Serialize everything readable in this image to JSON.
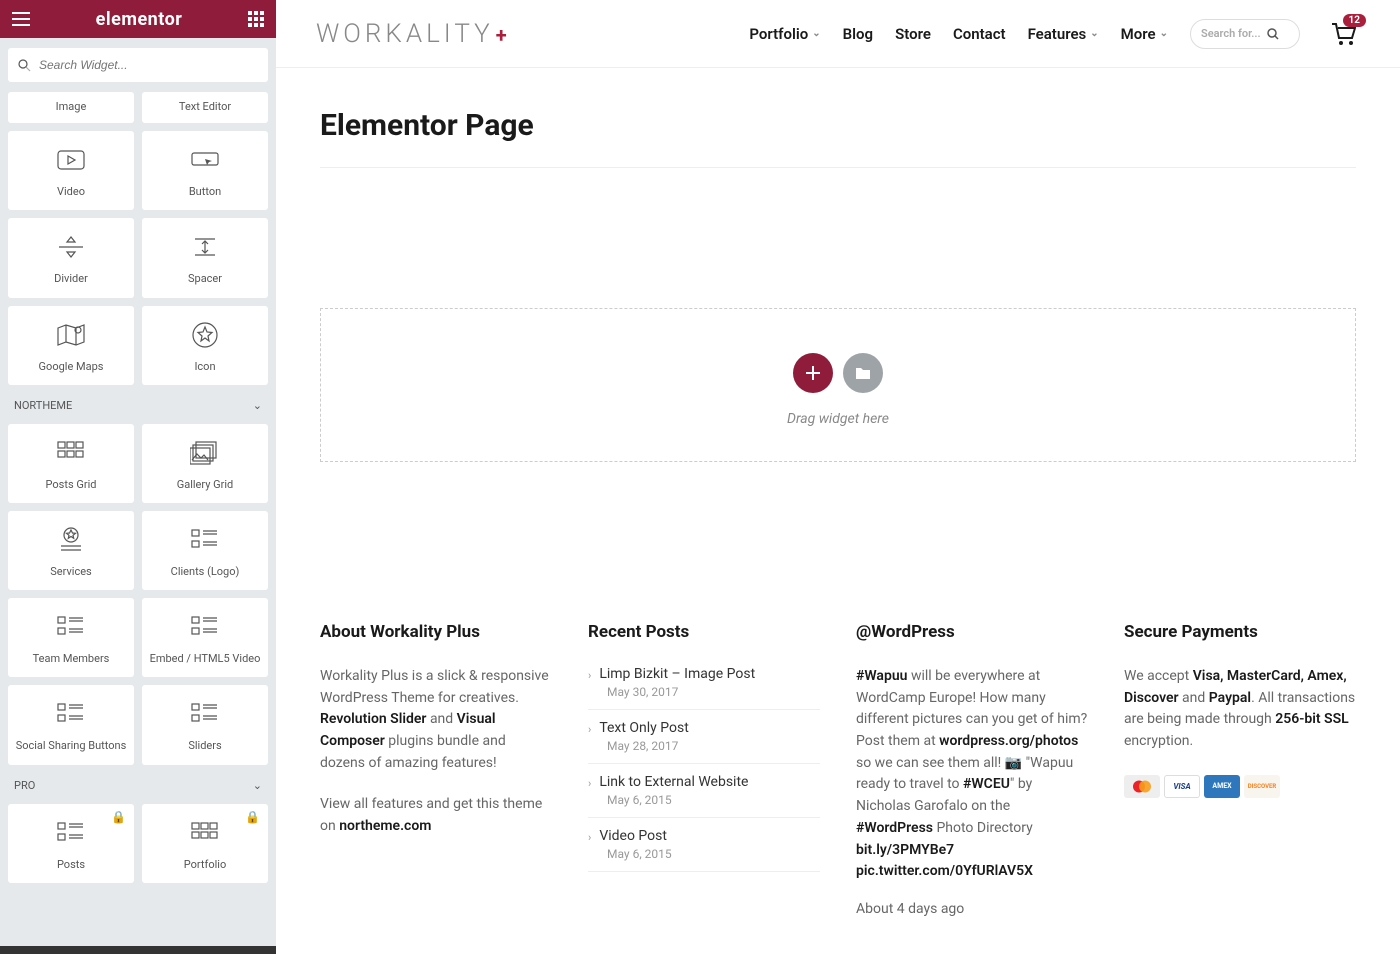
{
  "sidebar": {
    "brand": "elementor",
    "search_placeholder": "Search Widget...",
    "widgets_basic": [
      {
        "label": "Image"
      },
      {
        "label": "Text Editor"
      },
      {
        "label": "Video"
      },
      {
        "label": "Button"
      },
      {
        "label": "Divider"
      },
      {
        "label": "Spacer"
      },
      {
        "label": "Google Maps"
      },
      {
        "label": "Icon"
      }
    ],
    "section_northeme": "NORTHEME",
    "widgets_northeme": [
      {
        "label": "Posts Grid"
      },
      {
        "label": "Gallery Grid"
      },
      {
        "label": "Services"
      },
      {
        "label": "Clients (Logo)"
      },
      {
        "label": "Team Members"
      },
      {
        "label": "Embed / HTML5 Video"
      },
      {
        "label": "Social Sharing Buttons"
      },
      {
        "label": "Sliders"
      }
    ],
    "section_pro": "PRO",
    "widgets_pro": [
      {
        "label": "Posts"
      },
      {
        "label": "Portfolio"
      }
    ]
  },
  "preview": {
    "logo": "WORKALITY",
    "nav": [
      "Portfolio",
      "Blog",
      "Store",
      "Contact",
      "Features",
      "More"
    ],
    "search_placeholder": "Search for...",
    "cart_count": "12",
    "page_title": "Elementor Page",
    "dropzone_text": "Drag widget here"
  },
  "footer": {
    "about": {
      "heading": "About Workality Plus",
      "p1a": "Workality Plus is a slick & responsive WordPress Theme for creatives. ",
      "p1b_bold": "Revolution Slider",
      "p1c": " and ",
      "p1d_bold": "Visual Composer",
      "p1e": " plugins bundle and dozens of amazing features!",
      "p2a": "View all features and get this theme on ",
      "p2b_bold": "northeme.com"
    },
    "recent": {
      "heading": "Recent Posts",
      "items": [
        {
          "title": "Limp Bizkit – Image Post",
          "date": "May 30, 2017"
        },
        {
          "title": "Text Only Post",
          "date": "May 28, 2017"
        },
        {
          "title": "Link to External Website",
          "date": "May 6, 2015"
        },
        {
          "title": "Video Post",
          "date": "May 6, 2015"
        }
      ]
    },
    "twitter": {
      "heading": "@WordPress",
      "t1": "#Wapuu",
      "t2": " will be everywhere at WordCamp Europe! How many different pictures can you get of him? Post them at ",
      "t3": "wordpress.org/photos",
      "t4": " so we can see them all! 📷 \"Wapuu ready to travel to ",
      "t5": "#WCEU",
      "t6": "\" by Nicholas Garofalo on the ",
      "t7": "#WordPress",
      "t8": " Photo Directory ",
      "t9": "bit.ly/3PMYBe7 pic.twitter.com/0YfURlAV5X",
      "meta": "About 4 days ago"
    },
    "secure": {
      "heading": "Secure Payments",
      "s1": "We accept ",
      "s2": "Visa, MasterCard, Amex, Discover",
      "s3": " and ",
      "s4": "Paypal",
      "s5": ". All transactions are being made through ",
      "s6": "256-bit SSL",
      "s7": " encryption."
    }
  }
}
